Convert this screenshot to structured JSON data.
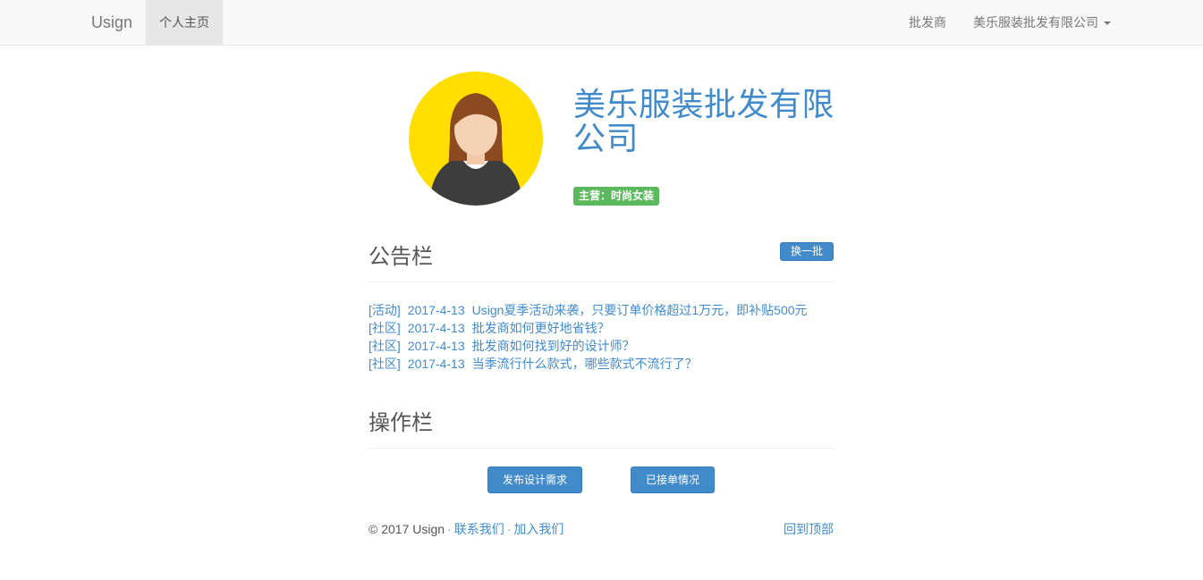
{
  "navbar": {
    "brand": "Usign",
    "active_tab": "个人主页",
    "right_links": [
      "批发商"
    ],
    "account_menu": "美乐服装批发有限公司"
  },
  "profile": {
    "company_name": "美乐服装批发有限公司",
    "badge": "主营：时尚女装",
    "avatar_icon": "woman-avatar-icon",
    "avatar_bg": "#ffde00"
  },
  "notice_board": {
    "title": "公告栏",
    "refresh_button": "换一批",
    "items": [
      {
        "category": "[活动]",
        "date": "2017-4-13",
        "text": "Usign夏季活动来袭，只要订单价格超过1万元，即补贴500元"
      },
      {
        "category": "[社区]",
        "date": "2017-4-13",
        "text": "批发商如何更好地省钱？"
      },
      {
        "category": "[社区]",
        "date": "2017-4-13",
        "text": "批发商如何找到好的设计师？"
      },
      {
        "category": "[社区]",
        "date": "2017-4-13",
        "text": "当季流行什么款式，哪些款式不流行了？"
      }
    ]
  },
  "operations": {
    "title": "操作栏",
    "publish_button": "发布设计需求",
    "orders_button": "已接单情况"
  },
  "footer": {
    "copyright": "© 2017 Usign",
    "contact_link": "联系我们",
    "join_link": "加入我们",
    "separator": "·",
    "back_to_top": "回到顶部"
  },
  "colors": {
    "primary": "#428bca",
    "success": "#5cb85c",
    "navbar_bg": "#f8f8f8"
  }
}
